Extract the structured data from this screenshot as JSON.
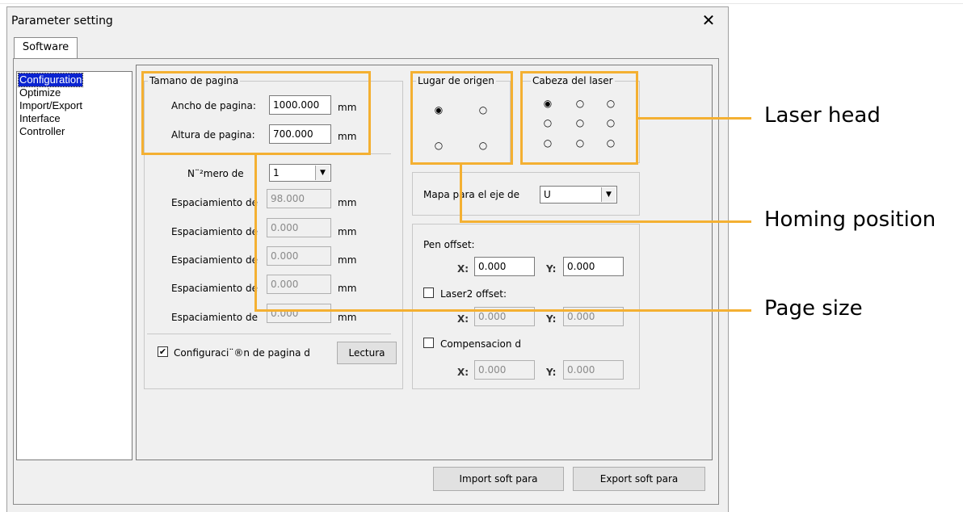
{
  "window": {
    "title": "Parameter setting",
    "close_glyph": "✕"
  },
  "tabs": [
    "Software"
  ],
  "tree": {
    "items": [
      "Configuration",
      "Optimize",
      "Import/Export",
      "Interface",
      "Controller"
    ],
    "selected": "Configuration"
  },
  "page_size": {
    "legend": "Tamano de pagina",
    "width_label": "Ancho de pagina:",
    "width_value": "1000.000",
    "width_unit": "mm",
    "height_label": "Altura de pagina:",
    "height_value": "700.000",
    "height_unit": "mm"
  },
  "heads": {
    "count_label": "N¨²mero de",
    "count_value": "1",
    "rows": [
      {
        "label": "Espaciamiento de",
        "value": "98.000",
        "unit": "mm"
      },
      {
        "label": "Espaciamiento de",
        "value": "0.000",
        "unit": "mm"
      },
      {
        "label": "Espaciamiento de",
        "value": "0.000",
        "unit": "mm"
      },
      {
        "label": "Espaciamiento de",
        "value": "0.000",
        "unit": "mm"
      },
      {
        "label": "Espaciamiento de",
        "value": "0.000",
        "unit": "mm"
      }
    ],
    "config_check_label": "Configuraci¨®n de pagina d",
    "config_checked": true,
    "read_button": "Lectura"
  },
  "origin": {
    "legend": "Lugar de origen",
    "selected_index": 0
  },
  "laser_head": {
    "legend": "Cabeza del laser",
    "selected_index": 0
  },
  "axis_map": {
    "label": "Mapa para el eje de",
    "value": "U"
  },
  "offsets": {
    "pen_label": "Pen offset:",
    "pen_x": "0.000",
    "pen_y": "0.000",
    "laser2_label": "Laser2 offset:",
    "laser2_checked": false,
    "laser2_x": "0.000",
    "laser2_y": "0.000",
    "comp_label": "Compensacion d",
    "comp_checked": false,
    "comp_x": "0.000",
    "comp_y": "0.000",
    "x_label": "X:",
    "y_label": "Y:"
  },
  "buttons": {
    "import": "Import soft para",
    "export": "Export soft para"
  },
  "callouts": {
    "laser_head": "Laser head",
    "homing": "Homing position",
    "page_size": "Page size"
  },
  "colors": {
    "highlight": "#f4b032",
    "selection": "#0a24d0"
  }
}
